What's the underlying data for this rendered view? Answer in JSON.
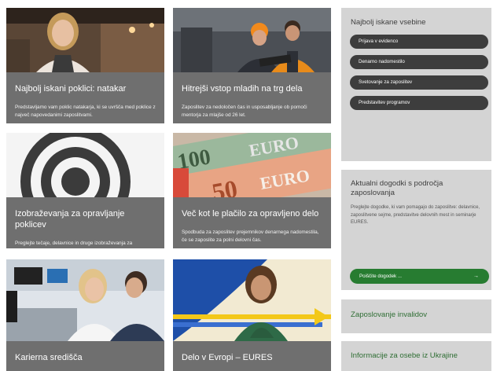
{
  "cards": [
    {
      "title": "Najbolj iskani poklici: natakar",
      "text": "Predstavljamo vam poklic natakarja, ki se uvršča med poklice z največ napovedanimi zaposlitvami."
    },
    {
      "title": "Hitrejši vstop mladih na trg dela",
      "text": "Zaposlitev za nedoločen čas in usposabljanje ob pomoči mentorja za mlajše od 26 let."
    },
    {
      "title": "Izobraževanja za opravljanje poklicev",
      "text": "Preglejte tečaje, delavnice in druge izobraževanja za opravljanje poklicev, ki jih iščejo delodajalci."
    },
    {
      "title": "Več kot le plačilo za opravljeno delo",
      "text": "Spodbuda za zaposlitev prejemnikov denarnega nadomestila, če se zaposlite za polni delovni čas."
    },
    {
      "title": "Karierna središča"
    },
    {
      "title": "Delo v Evropi – EURES"
    }
  ],
  "sidebar": {
    "popular_title": "Najbolj iskane vsebine",
    "popular_links": [
      "Prijava v evidenco",
      "Denarno nadomestilo",
      "Svetovanje za zaposlitev",
      "Predstavitev programov"
    ],
    "events_title": "Aktualni dogodki s področja zaposlovanja",
    "events_text": "Preglejte dogodke, ki vam pomagajo do zaposlitve: delavnice, zaposlitvene sejme, predstavitve delovnih mest in seminarje EURES.",
    "events_button": "Poiščite dogodek ...",
    "events_button_arrow": "→",
    "invalid_link": "Zaposlovanje invalidov",
    "ukraine_link": "Informacije za osebe iz Ukrajine"
  },
  "colors": {
    "panel": "#6f6f6f",
    "sidebar": "#d4d4d4",
    "pill": "#3d3d3d",
    "accent_green": "#277c31"
  },
  "photos": [
    "waitress-photo",
    "construction-workers-photo",
    "target-graphic",
    "euro-banknotes-photo",
    "office-colleagues-photo",
    "eures-woman-photo"
  ]
}
